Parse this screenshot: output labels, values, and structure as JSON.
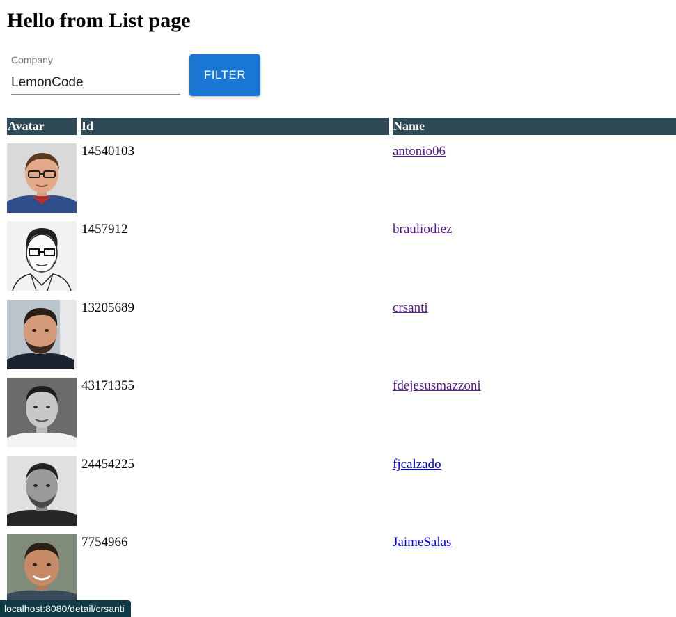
{
  "page": {
    "title": "Hello from List page"
  },
  "filter": {
    "label": "Company",
    "value": "LemonCode",
    "button_label": "FILTER"
  },
  "table": {
    "headers": [
      "Avatar",
      "Id",
      "Name"
    ],
    "rows": [
      {
        "id": "14540103",
        "name": "antonio06",
        "visited": true,
        "avatar_icon": "avatar-photo"
      },
      {
        "id": "1457912",
        "name": "brauliodiez",
        "visited": true,
        "avatar_icon": "avatar-sketch"
      },
      {
        "id": "13205689",
        "name": "crsanti",
        "visited": true,
        "avatar_icon": "avatar-photo"
      },
      {
        "id": "43171355",
        "name": "fdejesusmazzoni",
        "visited": true,
        "avatar_icon": "avatar-photo"
      },
      {
        "id": "24454225",
        "name": "fjcalzado",
        "visited": false,
        "avatar_icon": "avatar-photo"
      },
      {
        "id": "7754966",
        "name": "JaimeSalas",
        "visited": false,
        "avatar_icon": "avatar-photo"
      }
    ]
  },
  "status_bar": {
    "url": "localhost:8080/detail/crsanti"
  },
  "colors": {
    "header_bg": "#2e4a57",
    "button_bg": "#1976d2",
    "link_visited": "#551a8b",
    "link_unvisited": "#0000ee"
  }
}
